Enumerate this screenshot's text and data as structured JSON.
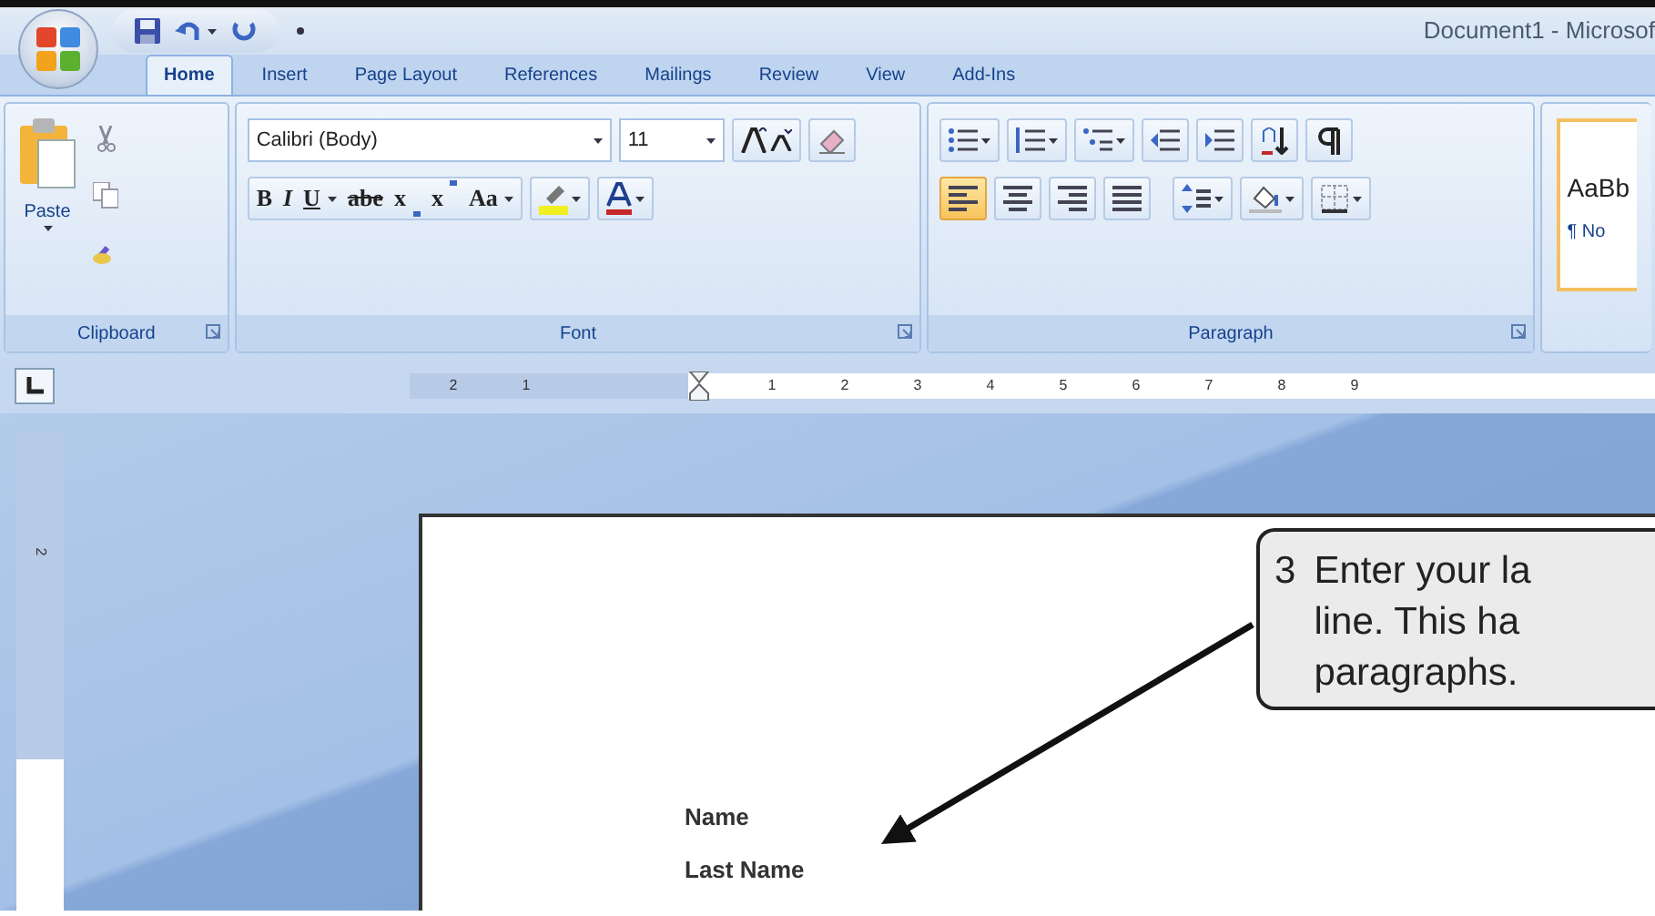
{
  "title_bar": {
    "title": "Document1 - Microsof"
  },
  "tabs": [
    {
      "label": "Home",
      "selected": true
    },
    {
      "label": "Insert",
      "selected": false
    },
    {
      "label": "Page Layout",
      "selected": false
    },
    {
      "label": "References",
      "selected": false
    },
    {
      "label": "Mailings",
      "selected": false
    },
    {
      "label": "Review",
      "selected": false
    },
    {
      "label": "View",
      "selected": false
    },
    {
      "label": "Add-Ins",
      "selected": false
    }
  ],
  "clipboard": {
    "label": "Clipboard",
    "paste": "Paste"
  },
  "font": {
    "label": "Font",
    "font_name": "Calibri (Body)",
    "font_size": "11",
    "format_buttons": [
      {
        "text": "B",
        "kind": "bold",
        "dropdown": false
      },
      {
        "text": "I",
        "kind": "italic",
        "dropdown": false
      },
      {
        "text": "U",
        "kind": "underline",
        "dropdown": true
      },
      {
        "text": "abe",
        "kind": "strike",
        "dropdown": false
      },
      {
        "text": "x",
        "kind": "sub",
        "dropdown": false
      },
      {
        "text": "x",
        "kind": "sup",
        "dropdown": false
      },
      {
        "text": "Aa",
        "kind": "plain",
        "dropdown": true
      }
    ]
  },
  "paragraph": {
    "label": "Paragraph",
    "alignment": [
      {
        "kind": "left",
        "selected": true
      },
      {
        "kind": "center",
        "selected": false
      },
      {
        "kind": "right",
        "selected": false
      },
      {
        "kind": "justify",
        "selected": false
      }
    ]
  },
  "styles": {
    "preview": "AaBb",
    "name": "¶ No"
  },
  "ruler": {
    "left_labels": [
      "2",
      "1"
    ],
    "right_labels": [
      "1",
      "2",
      "3",
      "4",
      "5",
      "6",
      "7",
      "8",
      "9"
    ]
  },
  "vertical_ruler": {
    "labels": [
      "2"
    ]
  },
  "document": {
    "lines": [
      "Name",
      "Last Name"
    ]
  },
  "callout": {
    "step": "3",
    "lines": [
      "Enter your la",
      "line.  This ha",
      "paragraphs."
    ]
  }
}
